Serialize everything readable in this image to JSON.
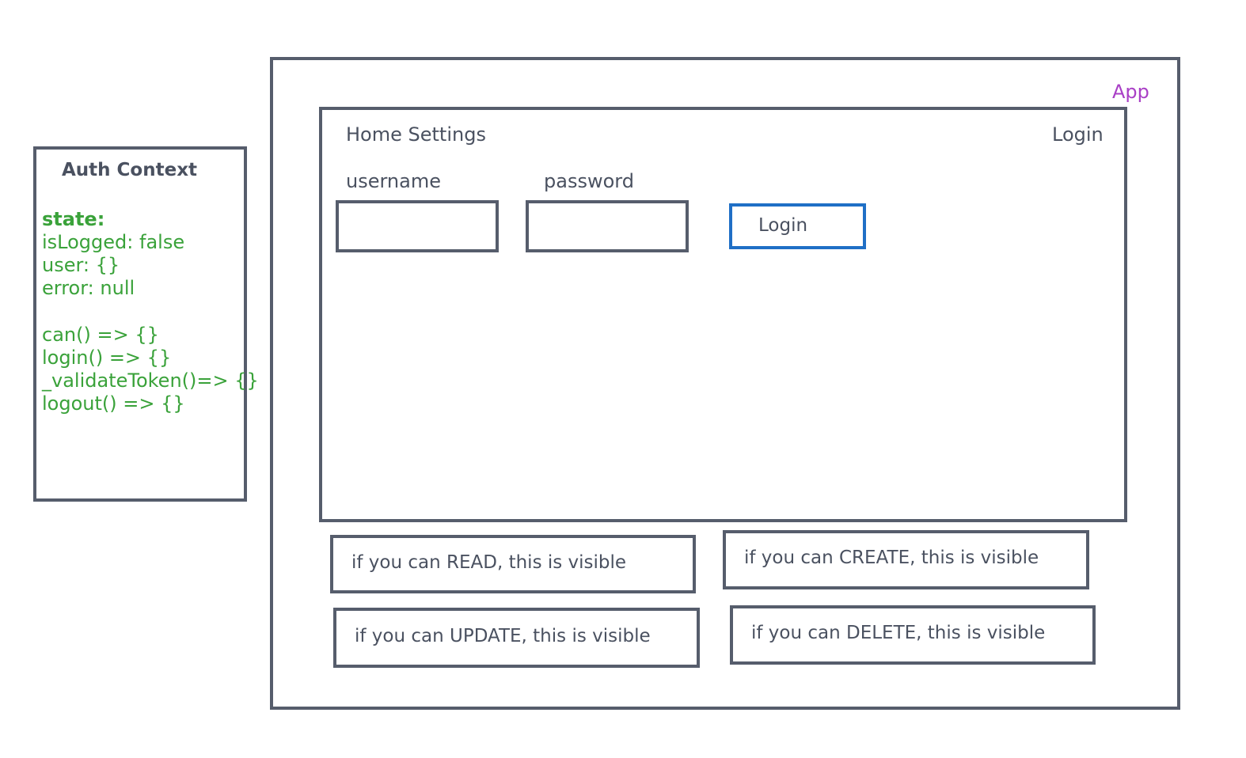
{
  "auth_context": {
    "title": "Auth Context",
    "state_label": "state:",
    "state_lines": [
      "isLogged: false",
      "user: {}",
      "error: null"
    ],
    "method_lines": [
      "can() => {}",
      "login() => {}",
      "_validateToken()=> {}",
      "logout() => {}"
    ]
  },
  "app": {
    "label": "App",
    "nav": {
      "links": "Home Settings",
      "login_link": "Login"
    },
    "login_form": {
      "username_label": "username",
      "password_label": "password",
      "username_value": "",
      "password_value": "",
      "submit_label": "Login"
    },
    "permissions": {
      "read": "if you can READ, this is visible",
      "create": "if you can CREATE, this is visible",
      "update": "if you can UPDATE, this is visible",
      "delete": "if you can DELETE, this is visible"
    }
  },
  "colors": {
    "frame_border": "#565d6c",
    "text": "#4a5160",
    "auth_state_text": "#3aa23a",
    "app_label": "#a93fc6",
    "login_button_border": "#1f6fc6"
  }
}
